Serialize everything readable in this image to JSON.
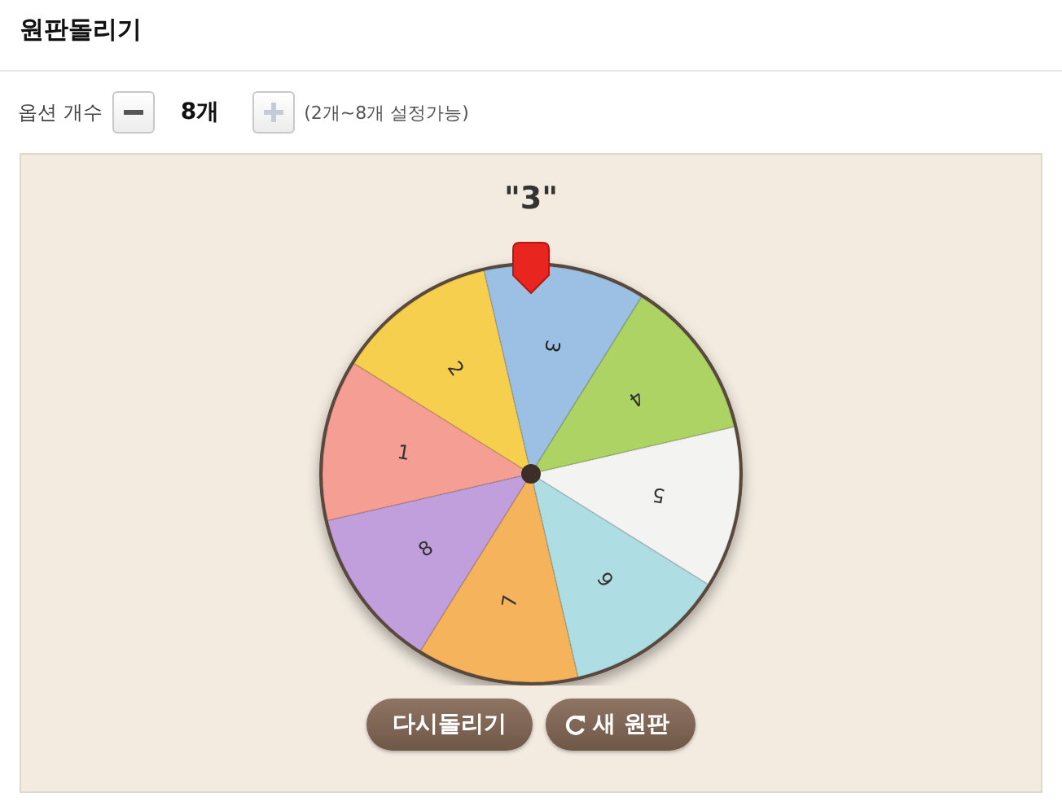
{
  "title": "원판돌리기",
  "options": {
    "label": "옵션 개수",
    "minus": {
      "disabled": false
    },
    "count": "8",
    "unit": "개",
    "plus": {
      "disabled": true
    },
    "hint": "(2개~8개 설정가능)"
  },
  "result": "\"3\"",
  "wheel": {
    "segments": [
      {
        "label": "1",
        "color": "#f59f94",
        "selected": false
      },
      {
        "label": "2",
        "color": "#f6cf4f",
        "selected": false
      },
      {
        "label": "3",
        "color": "#9bc0e4",
        "selected": true
      },
      {
        "label": "4",
        "color": "#acd363",
        "selected": false
      },
      {
        "label": "5",
        "color": "#f3f3f2",
        "selected": false
      },
      {
        "label": "6",
        "color": "#aedde4",
        "selected": false
      },
      {
        "label": "7",
        "color": "#f5b35c",
        "selected": false
      },
      {
        "label": "8",
        "color": "#c19fdc",
        "selected": false
      }
    ]
  },
  "buttons": [
    {
      "kind": "text",
      "label": "다시돌리기"
    },
    {
      "kind": "refresh",
      "label": "새 원판"
    }
  ]
}
